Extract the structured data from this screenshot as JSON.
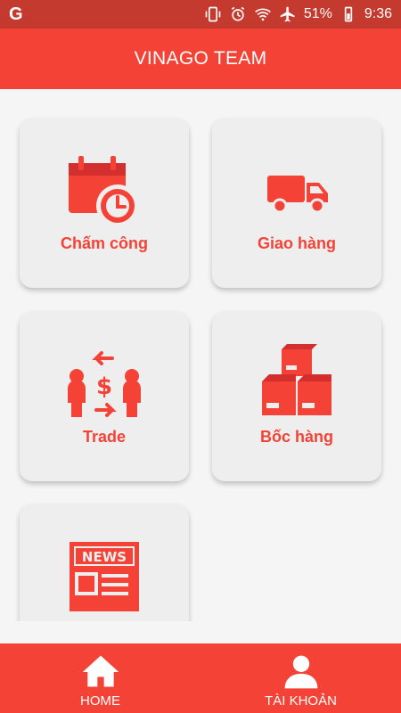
{
  "status_bar": {
    "left_icon": "google-g-icon",
    "battery": "51%",
    "time": "9:36"
  },
  "header": {
    "title": "VINAGO TEAM"
  },
  "tiles": [
    {
      "label": "Chấm công",
      "icon": "calendar-clock-icon"
    },
    {
      "label": "Giao hàng",
      "icon": "delivery-truck-icon"
    },
    {
      "label": "Trade",
      "icon": "trade-exchange-icon"
    },
    {
      "label": "Bốc hàng",
      "icon": "boxes-icon"
    },
    {
      "label": "",
      "icon": "news-icon"
    }
  ],
  "bottom_nav": {
    "home_label": "HOME",
    "account_label": "TÀI KHOẢN"
  },
  "colors": {
    "primary": "#f44336",
    "status_bar": "#c53a2f",
    "tile_bg": "#eeeeee"
  }
}
